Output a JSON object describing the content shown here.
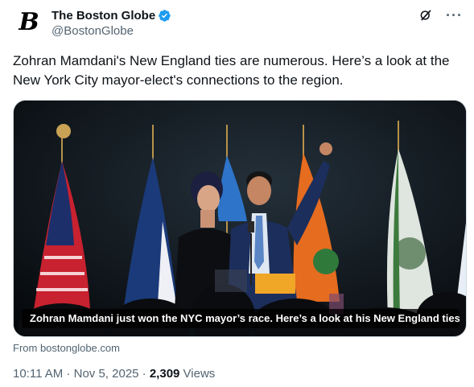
{
  "author": {
    "display_name": "The Boston Globe",
    "handle": "@BostonGlobe",
    "avatar_glyph": "B",
    "verified": true,
    "verified_color": "#1d9bf0"
  },
  "header_icons": [
    "grok-icon",
    "more-icon"
  ],
  "more_label": "···",
  "tweet": {
    "text": "Zohran Mamdani's New England ties are numerous. Here’s a look at the New York City mayor-elect's connections to the region."
  },
  "media": {
    "caption": "Zohran Mamdani just won the NYC mayor’s race. Here’s a look at his New England ties....",
    "source": "From bostonglobe.com"
  },
  "meta": {
    "time": "10:11 AM",
    "separator1": " · ",
    "date": "Nov 5, 2025",
    "separator2": " · ",
    "views_count": "2,309",
    "views_label": " Views"
  },
  "colors": {
    "text": "#0f1419",
    "secondary": "#536471",
    "accent": "#1d9bf0"
  }
}
